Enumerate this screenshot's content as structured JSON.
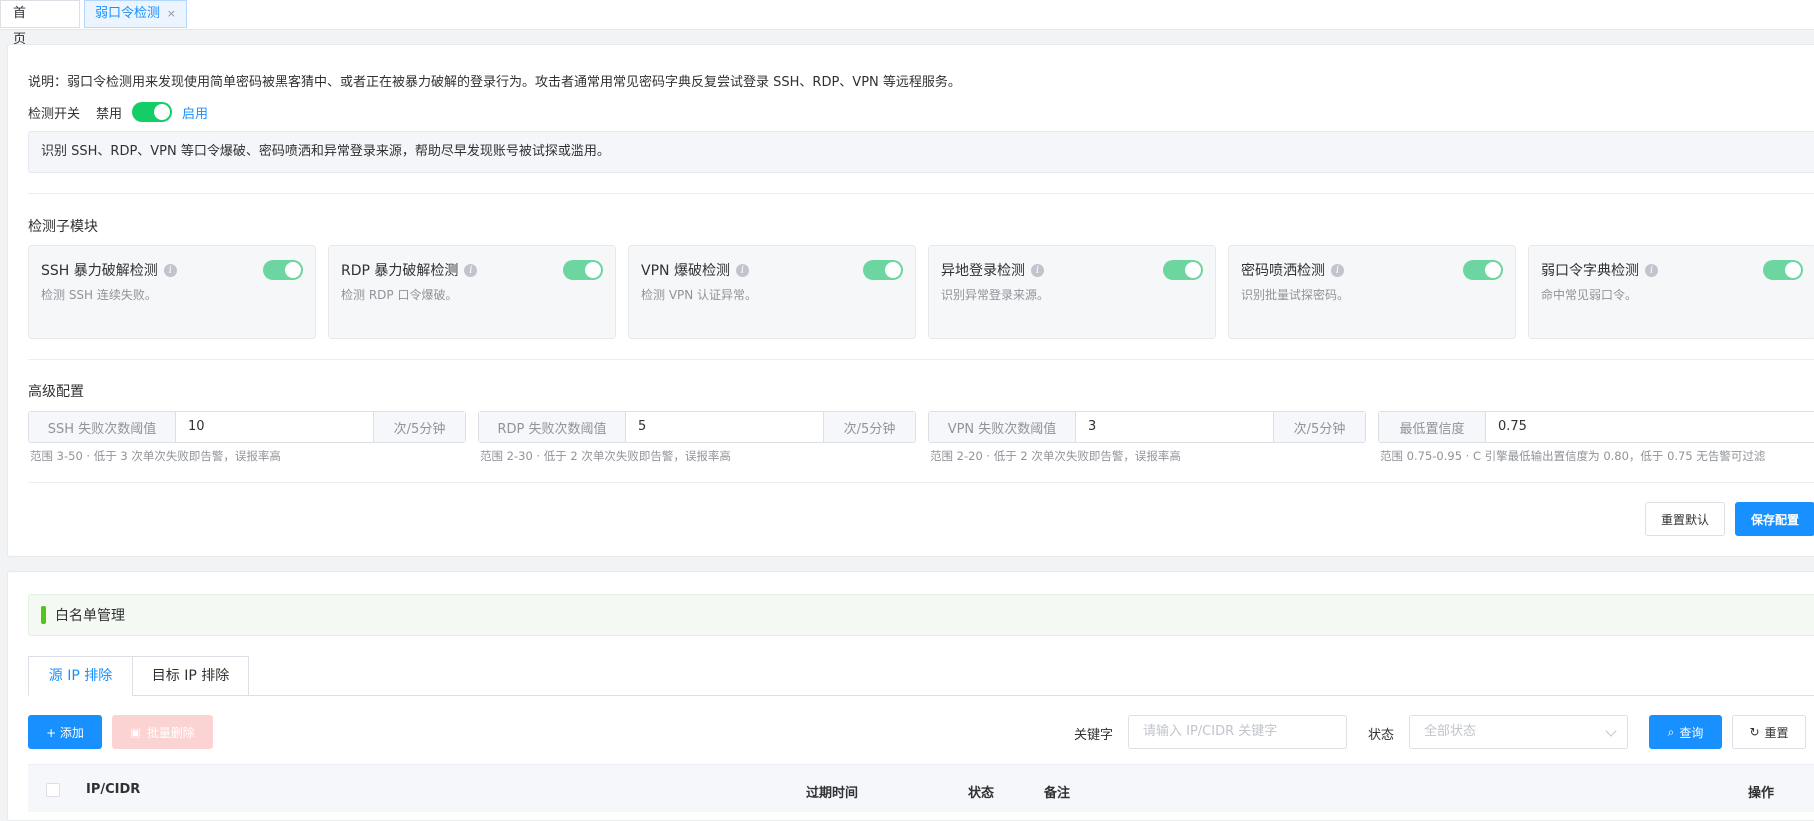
{
  "page_tabs": {
    "home": "首页",
    "active": "弱口令检测",
    "close": "×"
  },
  "description": "说明：弱口令检测用来发现使用简单密码被黑客猜中、或者正在被暴力破解的登录行为。攻击者通常用常见密码字典反复尝试登录 SSH、RDP、VPN 等远程服务。",
  "detection_switch": {
    "label": "检测开关",
    "off_label": "禁用",
    "on_label": "启用",
    "enabled": true
  },
  "info_text": "识别 SSH、RDP、VPN 等口令爆破、密码喷洒和异常登录来源，帮助尽早发现账号被试探或滥用。",
  "modules_title": "检测子模块",
  "modules": [
    {
      "title": "SSH 暴力破解检测",
      "desc": "检测 SSH 连续失败。",
      "enabled": true
    },
    {
      "title": "RDP 暴力破解检测",
      "desc": "检测 RDP 口令爆破。",
      "enabled": true
    },
    {
      "title": "VPN 爆破检测",
      "desc": "检测 VPN 认证异常。",
      "enabled": true
    },
    {
      "title": "异地登录检测",
      "desc": "识别异常登录来源。",
      "enabled": true
    },
    {
      "title": "密码喷洒检测",
      "desc": "识别批量试探密码。",
      "enabled": true
    },
    {
      "title": "弱口令字典检测",
      "desc": "命中常见弱口令。",
      "enabled": true
    }
  ],
  "advanced_title": "高级配置",
  "configs": [
    {
      "label": "SSH 失败次数阈值",
      "value": "10",
      "unit": "次/5分钟",
      "hint": "范围 3-50 · 低于 3 次单次失败即告警，误报率高"
    },
    {
      "label": "RDP 失败次数阈值",
      "value": "5",
      "unit": "次/5分钟",
      "hint": "范围 2-30 · 低于 2 次单次失败即告警，误报率高"
    },
    {
      "label": "VPN 失败次数阈值",
      "value": "3",
      "unit": "次/5分钟",
      "hint": "范围 2-20 · 低于 2 次单次失败即告警，误报率高"
    },
    {
      "label": "最低置信度",
      "value": "0.75",
      "unit": "",
      "hint": "范围 0.75-0.95 · C 引擎最低输出置信度为 0.80，低于 0.75 无告警可过滤"
    }
  ],
  "buttons": {
    "reset_default": "重置默认",
    "save_config": "保存配置"
  },
  "whitelist": {
    "title": "白名单管理",
    "tabs": [
      "源 IP 排除",
      "目标 IP 排除"
    ],
    "add": "+ 添加",
    "batch_delete": "批量删除",
    "keyword_label": "关键字",
    "keyword_placeholder": "请输入 IP/CIDR 关键字",
    "status_label": "状态",
    "status_placeholder": "全部状态",
    "query": "查询",
    "reset": "重置",
    "columns": [
      "IP/CIDR",
      "过期时间",
      "状态",
      "备注",
      "操作"
    ]
  },
  "colors": {
    "primary": "#1890ff",
    "switch_on": "#13ce66",
    "accent_green": "#52c41a",
    "danger_disabled": "#fcd3d3"
  }
}
